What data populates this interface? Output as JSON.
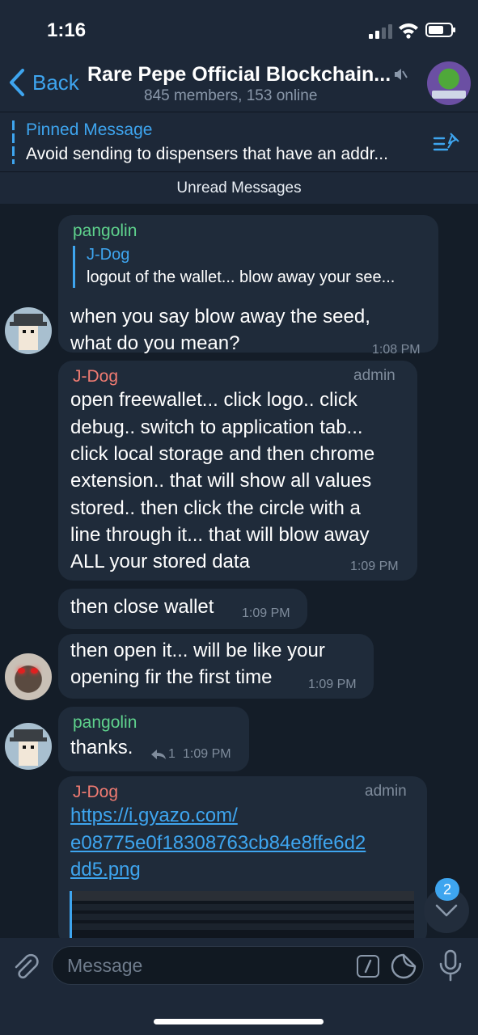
{
  "status": {
    "time": "1:16"
  },
  "nav": {
    "back_label": "Back",
    "title": "Rare Pepe Official Blockchain...",
    "subtitle": "845 members, 153 online"
  },
  "pinned": {
    "title": "Pinned Message",
    "text": "Avoid sending to dispensers that have an addr..."
  },
  "unread_label": "Unread Messages",
  "messages": [
    {
      "sender": "pangolin",
      "reply_to_name": "J-Dog",
      "reply_to_text": "logout of the wallet... blow away your see...",
      "lines": [
        "when you say blow away the seed,",
        "what do you mean?"
      ],
      "time": "1:08 PM"
    },
    {
      "sender": "J-Dog",
      "badge": "admin",
      "lines": [
        "open freewallet... click logo.. click",
        "debug.. switch to application tab...",
        "click local storage and then chrome",
        "extension.. that will show all values",
        "stored.. then click the circle with a",
        "line through it... that will blow away",
        "ALL your stored data"
      ],
      "time": "1:09 PM"
    },
    {
      "lines": [
        "then close wallet"
      ],
      "time": "1:09 PM"
    },
    {
      "lines": [
        "then open it... will be like your",
        "opening fir the first time"
      ],
      "time": "1:09 PM"
    },
    {
      "sender": "pangolin",
      "lines": [
        "thanks."
      ],
      "replies": "1",
      "time": "1:09 PM"
    },
    {
      "sender": "J-Dog",
      "badge": "admin",
      "lines": [
        "https://i.gyazo.com/",
        "e08775e0f18308763cb84e8ffe6d2",
        "dd5.png"
      ]
    }
  ],
  "scroll": {
    "unread_count": "2"
  },
  "composer": {
    "placeholder": "Message"
  },
  "colors": {
    "accent": "#3ea5ef",
    "sender_green": "#5fd38d",
    "sender_red": "#f07b72",
    "bubble": "#1f2b3a"
  }
}
